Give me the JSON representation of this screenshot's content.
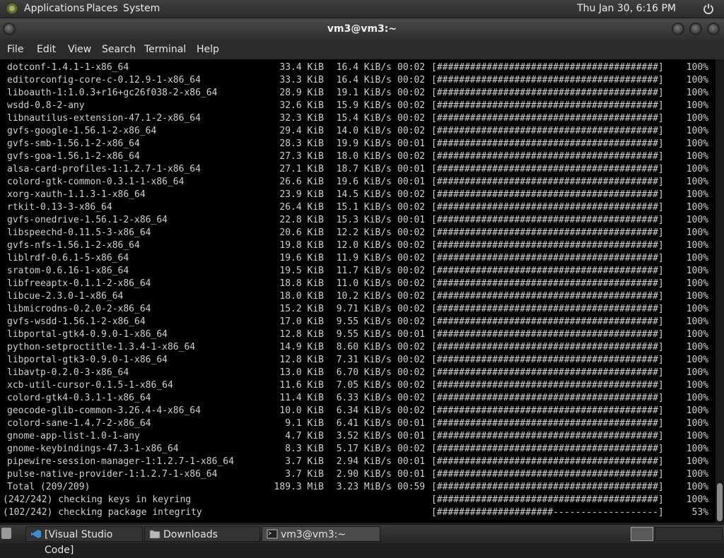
{
  "top_panel": {
    "menus": [
      "Applications",
      "Places",
      "System"
    ],
    "clock": "Thu Jan 30,  6:16 PM"
  },
  "window": {
    "title": "vm3@vm3:~"
  },
  "menubar": [
    "File",
    "Edit",
    "View",
    "Search",
    "Terminal",
    "Help"
  ],
  "terminal": {
    "packages": [
      {
        "name": "dotconf-1.4.1-1-x86_64",
        "size": "33.4 KiB",
        "rate": "16.4 KiB/s",
        "time": "00:02",
        "bar": "[########################################]",
        "pct": "100%"
      },
      {
        "name": "editorconfig-core-c-0.12.9-1-x86_64",
        "size": "33.3 KiB",
        "rate": "16.4 KiB/s",
        "time": "00:02",
        "bar": "[########################################]",
        "pct": "100%"
      },
      {
        "name": "liboauth-1:1.0.3+r16+gc26f038-2-x86_64",
        "size": "28.9 KiB",
        "rate": "19.1 KiB/s",
        "time": "00:02",
        "bar": "[########################################]",
        "pct": "100%"
      },
      {
        "name": "wsdd-0.8-2-any",
        "size": "32.6 KiB",
        "rate": "15.9 KiB/s",
        "time": "00:02",
        "bar": "[########################################]",
        "pct": "100%"
      },
      {
        "name": "libnautilus-extension-47.1-2-x86_64",
        "size": "32.3 KiB",
        "rate": "15.4 KiB/s",
        "time": "00:02",
        "bar": "[########################################]",
        "pct": "100%"
      },
      {
        "name": "gvfs-google-1.56.1-2-x86_64",
        "size": "29.4 KiB",
        "rate": "14.0 KiB/s",
        "time": "00:02",
        "bar": "[########################################]",
        "pct": "100%"
      },
      {
        "name": "gvfs-smb-1.56.1-2-x86_64",
        "size": "28.3 KiB",
        "rate": "19.9 KiB/s",
        "time": "00:01",
        "bar": "[########################################]",
        "pct": "100%"
      },
      {
        "name": "gvfs-goa-1.56.1-2-x86_64",
        "size": "27.3 KiB",
        "rate": "18.0 KiB/s",
        "time": "00:02",
        "bar": "[########################################]",
        "pct": "100%"
      },
      {
        "name": "alsa-card-profiles-1:1.2.7-1-x86_64",
        "size": "27.1 KiB",
        "rate": "18.7 KiB/s",
        "time": "00:01",
        "bar": "[########################################]",
        "pct": "100%"
      },
      {
        "name": "colord-gtk-common-0.3.1-1-x86_64",
        "size": "26.6 KiB",
        "rate": "19.6 KiB/s",
        "time": "00:01",
        "bar": "[########################################]",
        "pct": "100%"
      },
      {
        "name": "xorg-xauth-1.1.3-1-x86_64",
        "size": "23.9 KiB",
        "rate": "14.5 KiB/s",
        "time": "00:02",
        "bar": "[########################################]",
        "pct": "100%"
      },
      {
        "name": "rtkit-0.13-3-x86_64",
        "size": "26.4 KiB",
        "rate": "15.1 KiB/s",
        "time": "00:02",
        "bar": "[########################################]",
        "pct": "100%"
      },
      {
        "name": "gvfs-onedrive-1.56.1-2-x86_64",
        "size": "22.8 KiB",
        "rate": "15.3 KiB/s",
        "time": "00:01",
        "bar": "[########################################]",
        "pct": "100%"
      },
      {
        "name": "libspeechd-0.11.5-3-x86_64",
        "size": "20.6 KiB",
        "rate": "12.2 KiB/s",
        "time": "00:02",
        "bar": "[########################################]",
        "pct": "100%"
      },
      {
        "name": "gvfs-nfs-1.56.1-2-x86_64",
        "size": "19.8 KiB",
        "rate": "12.0 KiB/s",
        "time": "00:02",
        "bar": "[########################################]",
        "pct": "100%"
      },
      {
        "name": "liblrdf-0.6.1-5-x86_64",
        "size": "19.6 KiB",
        "rate": "11.9 KiB/s",
        "time": "00:02",
        "bar": "[########################################]",
        "pct": "100%"
      },
      {
        "name": "sratom-0.6.16-1-x86_64",
        "size": "19.5 KiB",
        "rate": "11.7 KiB/s",
        "time": "00:02",
        "bar": "[########################################]",
        "pct": "100%"
      },
      {
        "name": "libfreeaptx-0.1.1-2-x86_64",
        "size": "18.8 KiB",
        "rate": "11.0 KiB/s",
        "time": "00:02",
        "bar": "[########################################]",
        "pct": "100%"
      },
      {
        "name": "libcue-2.3.0-1-x86_64",
        "size": "18.0 KiB",
        "rate": "10.2 KiB/s",
        "time": "00:02",
        "bar": "[########################################]",
        "pct": "100%"
      },
      {
        "name": "libmicrodns-0.2.0-2-x86_64",
        "size": "15.2 KiB",
        "rate": "9.71 KiB/s",
        "time": "00:02",
        "bar": "[########################################]",
        "pct": "100%"
      },
      {
        "name": "gvfs-wsdd-1.56.1-2-x86_64",
        "size": "17.0 KiB",
        "rate": "9.55 KiB/s",
        "time": "00:02",
        "bar": "[########################################]",
        "pct": "100%"
      },
      {
        "name": "libportal-gtk4-0.9.0-1-x86_64",
        "size": "12.8 KiB",
        "rate": "9.55 KiB/s",
        "time": "00:01",
        "bar": "[########################################]",
        "pct": "100%"
      },
      {
        "name": "python-setproctitle-1.3.4-1-x86_64",
        "size": "14.9 KiB",
        "rate": "8.60 KiB/s",
        "time": "00:02",
        "bar": "[########################################]",
        "pct": "100%"
      },
      {
        "name": "libportal-gtk3-0.9.0-1-x86_64",
        "size": "12.8 KiB",
        "rate": "7.31 KiB/s",
        "time": "00:02",
        "bar": "[########################################]",
        "pct": "100%"
      },
      {
        "name": "libavtp-0.2.0-3-x86_64",
        "size": "13.0 KiB",
        "rate": "6.70 KiB/s",
        "time": "00:02",
        "bar": "[########################################]",
        "pct": "100%"
      },
      {
        "name": "xcb-util-cursor-0.1.5-1-x86_64",
        "size": "11.6 KiB",
        "rate": "7.05 KiB/s",
        "time": "00:02",
        "bar": "[########################################]",
        "pct": "100%"
      },
      {
        "name": "colord-gtk4-0.3.1-1-x86_64",
        "size": "11.4 KiB",
        "rate": "6.33 KiB/s",
        "time": "00:02",
        "bar": "[########################################]",
        "pct": "100%"
      },
      {
        "name": "geocode-glib-common-3.26.4-4-x86_64",
        "size": "10.0 KiB",
        "rate": "6.34 KiB/s",
        "time": "00:02",
        "bar": "[########################################]",
        "pct": "100%"
      },
      {
        "name": "colord-sane-1.4.7-2-x86_64",
        "size": "9.1 KiB",
        "rate": "6.41 KiB/s",
        "time": "00:01",
        "bar": "[########################################]",
        "pct": "100%"
      },
      {
        "name": "gnome-app-list-1.0-1-any",
        "size": "4.7 KiB",
        "rate": "3.52 KiB/s",
        "time": "00:01",
        "bar": "[########################################]",
        "pct": "100%"
      },
      {
        "name": "gnome-keybindings-47.3-1-x86_64",
        "size": "8.3 KiB",
        "rate": "5.17 KiB/s",
        "time": "00:02",
        "bar": "[########################################]",
        "pct": "100%"
      },
      {
        "name": "pipewire-session-manager-1:1.2.7-1-x86_64",
        "size": "3.7 KiB",
        "rate": "2.94 KiB/s",
        "time": "00:01",
        "bar": "[########################################]",
        "pct": "100%"
      },
      {
        "name": "pulse-native-provider-1:1.2.7-1-x86_64",
        "size": "3.7 KiB",
        "rate": "2.90 KiB/s",
        "time": "00:01",
        "bar": "[########################################]",
        "pct": "100%"
      }
    ],
    "total": {
      "name": "Total (209/209)",
      "size": "189.3 MiB",
      "rate": "3.23 MiB/s",
      "time": "00:59",
      "bar": "[########################################]",
      "pct": "100%"
    },
    "steps": [
      {
        "msg": "(242/242) checking keys in keyring",
        "bar": "[########################################]",
        "pct": "100%"
      },
      {
        "msg": "(102/242) checking package integrity",
        "bar": "[#####################-------------------]",
        "pct": "53%"
      }
    ]
  },
  "taskbar": {
    "tasks": [
      "[Visual Studio Code]",
      "Downloads",
      "vm3@vm3:~"
    ]
  }
}
